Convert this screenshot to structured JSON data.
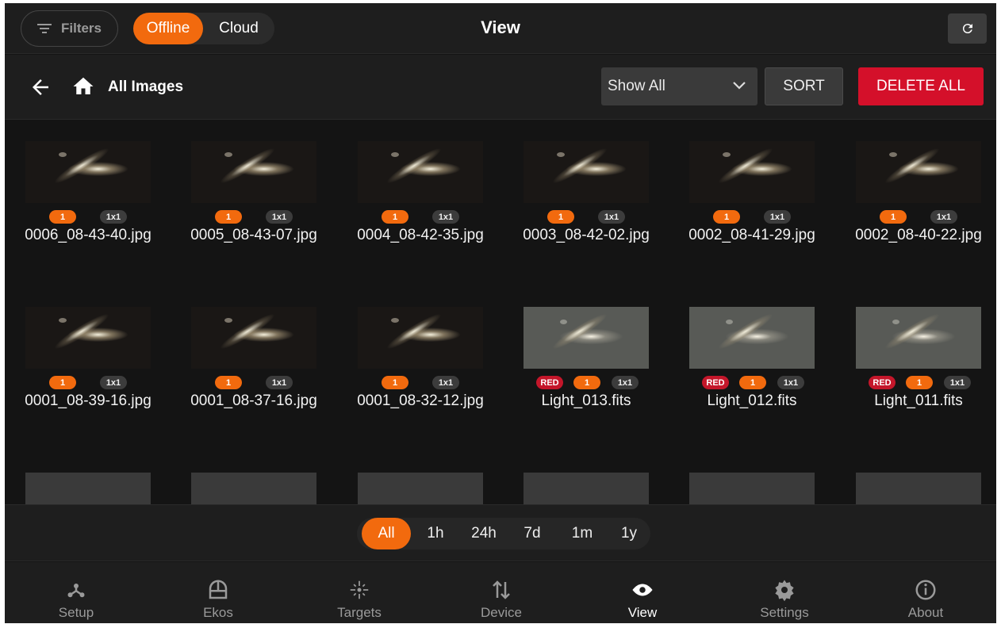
{
  "header": {
    "filters_label": "Filters",
    "source_tabs": [
      {
        "label": "Offline",
        "selected": true
      },
      {
        "label": "Cloud",
        "selected": false
      }
    ],
    "title": "View",
    "refresh_icon": "refresh-icon"
  },
  "toolbar": {
    "breadcrumb": "All Images",
    "filter_select_value": "Show All",
    "sort_label": "SORT",
    "delete_all_label": "DELETE ALL"
  },
  "images": [
    {
      "name": "0006_08-43-40.jpg",
      "count": "1",
      "binning": "1x1"
    },
    {
      "name": "0005_08-43-07.jpg",
      "count": "1",
      "binning": "1x1"
    },
    {
      "name": "0004_08-42-35.jpg",
      "count": "1",
      "binning": "1x1"
    },
    {
      "name": "0003_08-42-02.jpg",
      "count": "1",
      "binning": "1x1"
    },
    {
      "name": "0002_08-41-29.jpg",
      "count": "1",
      "binning": "1x1"
    },
    {
      "name": "0002_08-40-22.jpg",
      "count": "1",
      "binning": "1x1"
    },
    {
      "name": "0001_08-39-16.jpg",
      "count": "1",
      "binning": "1x1"
    },
    {
      "name": "0001_08-37-16.jpg",
      "count": "1",
      "binning": "1x1"
    },
    {
      "name": "0001_08-32-12.jpg",
      "count": "1",
      "binning": "1x1"
    },
    {
      "name": "Light_013.fits",
      "filter": "RED",
      "count": "1",
      "binning": "1x1"
    },
    {
      "name": "Light_012.fits",
      "filter": "RED",
      "count": "1",
      "binning": "1x1"
    },
    {
      "name": "Light_011.fits",
      "filter": "RED",
      "count": "1",
      "binning": "1x1"
    }
  ],
  "time_range": [
    {
      "label": "All",
      "selected": true
    },
    {
      "label": "1h",
      "selected": false
    },
    {
      "label": "24h",
      "selected": false
    },
    {
      "label": "7d",
      "selected": false
    },
    {
      "label": "1m",
      "selected": false
    },
    {
      "label": "1y",
      "selected": false
    }
  ],
  "bottom_nav": [
    {
      "label": "Setup",
      "icon": "setup-icon",
      "active": false
    },
    {
      "label": "Ekos",
      "icon": "observatory-dome-icon",
      "active": false
    },
    {
      "label": "Targets",
      "icon": "targets-icon",
      "active": false
    },
    {
      "label": "Device",
      "icon": "transfer-arrows-icon",
      "active": false
    },
    {
      "label": "View",
      "icon": "eye-icon",
      "active": true
    },
    {
      "label": "Settings",
      "icon": "gear-icon",
      "active": false
    },
    {
      "label": "About",
      "icon": "info-icon",
      "active": false
    }
  ],
  "colors": {
    "accent": "#f26a0e",
    "danger": "#d4102a",
    "background": "#141414",
    "surface": "#1e1e1e"
  }
}
